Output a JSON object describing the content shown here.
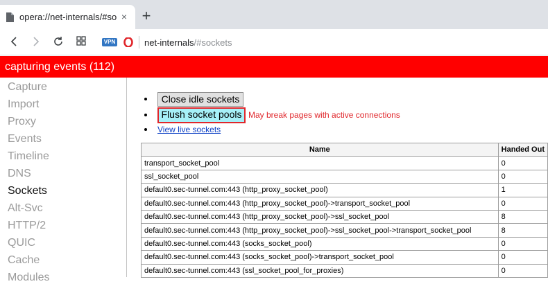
{
  "tab": {
    "title": "opera://net-internals/#soc",
    "close_glyph": "×",
    "new_tab_glyph": "+"
  },
  "toolbar": {
    "vpn_label": "VPN",
    "url_host": "net-internals",
    "url_fragment": "/#sockets"
  },
  "capture_bar": {
    "text": "capturing events (112)"
  },
  "sidebar": {
    "items": [
      {
        "label": "Capture"
      },
      {
        "label": "Import"
      },
      {
        "label": "Proxy"
      },
      {
        "label": "Events"
      },
      {
        "label": "Timeline"
      },
      {
        "label": "DNS"
      },
      {
        "label": "Sockets"
      },
      {
        "label": "Alt-Svc"
      },
      {
        "label": "HTTP/2"
      },
      {
        "label": "QUIC"
      },
      {
        "label": "Cache"
      },
      {
        "label": "Modules"
      }
    ],
    "active": "Sockets"
  },
  "actions": {
    "close_idle_label": "Close idle sockets",
    "flush_label": "Flush socket pools",
    "flush_warning": "May break pages with active connections",
    "view_live_label": "View live sockets"
  },
  "table": {
    "headers": [
      "Name",
      "Handed Out"
    ],
    "rows": [
      [
        "transport_socket_pool",
        "0"
      ],
      [
        "ssl_socket_pool",
        "0"
      ],
      [
        "default0.sec-tunnel.com:443 (http_proxy_socket_pool)",
        "1"
      ],
      [
        "default0.sec-tunnel.com:443 (http_proxy_socket_pool)->transport_socket_pool",
        "0"
      ],
      [
        "default0.sec-tunnel.com:443 (http_proxy_socket_pool)->ssl_socket_pool",
        "8"
      ],
      [
        "default0.sec-tunnel.com:443 (http_proxy_socket_pool)->ssl_socket_pool->transport_socket_pool",
        "8"
      ],
      [
        "default0.sec-tunnel.com:443 (socks_socket_pool)",
        "0"
      ],
      [
        "default0.sec-tunnel.com:443 (socks_socket_pool)->transport_socket_pool",
        "0"
      ],
      [
        "default0.sec-tunnel.com:443 (ssl_socket_pool_for_proxies)",
        "0"
      ]
    ]
  },
  "colors": {
    "capture_bar": "#ff0000",
    "flush_button_bg": "#a6f0f8",
    "flush_button_border": "#e0262b",
    "link": "#0b3fc5"
  }
}
